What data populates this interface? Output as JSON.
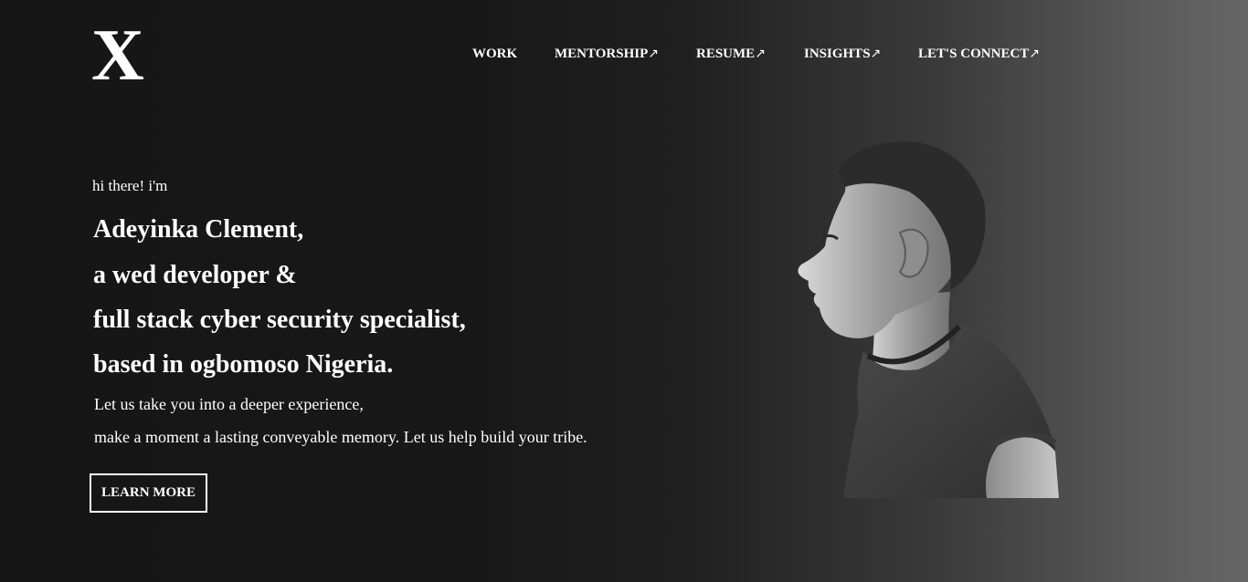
{
  "logo": {
    "text": "X"
  },
  "nav": {
    "items": [
      {
        "label": "WORK",
        "arrow": ""
      },
      {
        "label": "MENTORSHIP",
        "arrow": "↗"
      },
      {
        "label": "RESUME",
        "arrow": "↗"
      },
      {
        "label": "INSIGHTS",
        "arrow": "↗"
      },
      {
        "label": "LET'S CONNECT",
        "arrow": "↗"
      }
    ]
  },
  "hero": {
    "intro": "hi there! i'm",
    "lines": [
      "Adeyinka Clement,",
      "a wed developer &",
      "full stack cyber security specialist,",
      "based in ogbomoso Nigeria."
    ],
    "subtext": [
      "Let us take you into a deeper experience,",
      "make a moment a lasting conveyable memory. Let us help build your tribe."
    ],
    "button_label": "LEARN MORE"
  },
  "portrait": {
    "description_icon": "profile-photo"
  },
  "colors": {
    "background_dark": "#161616",
    "background_light": "#666666",
    "text": "#ffffff"
  }
}
